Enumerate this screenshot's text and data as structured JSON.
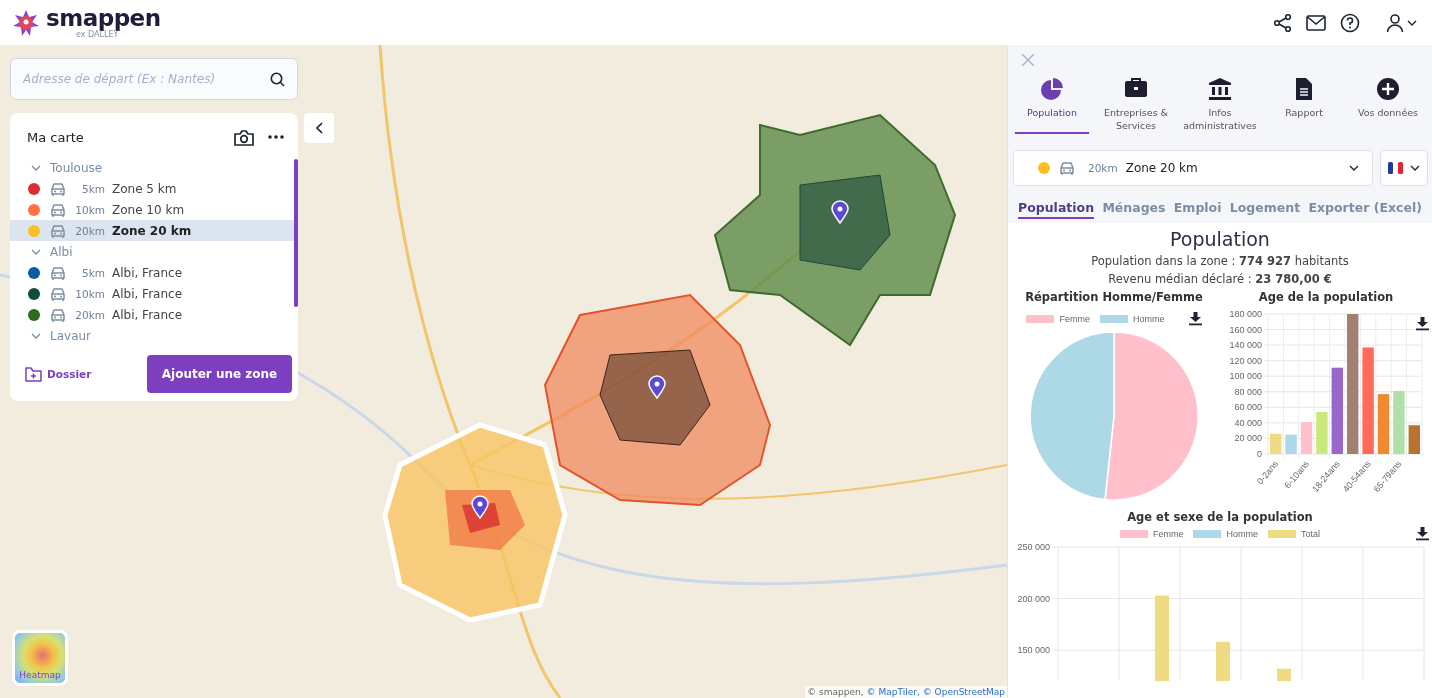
{
  "header": {
    "logo": {
      "name": "smappen",
      "sub": "ex DALLEY"
    }
  },
  "search": {
    "placeholder": "Adresse de départ (Ex : Nantes)"
  },
  "my_map": {
    "title": "Ma carte",
    "groups": [
      {
        "name": "Toulouse",
        "zones": [
          {
            "color": "#d92f2f",
            "distance": "5km",
            "label": "Zone 5 km",
            "selected": false
          },
          {
            "color": "#ff7043",
            "distance": "10km",
            "label": "Zone 10 km",
            "selected": false
          },
          {
            "color": "#fbbf24",
            "distance": "20km",
            "label": "Zone 20 km",
            "selected": true
          }
        ]
      },
      {
        "name": "Albi",
        "zones": [
          {
            "color": "#0d5aa7",
            "distance": "5km",
            "label": "Albi, France",
            "selected": false
          },
          {
            "color": "#0f4d3a",
            "distance": "10km",
            "label": "Albi, France",
            "selected": false
          },
          {
            "color": "#2e6b1f",
            "distance": "20km",
            "label": "Albi, France",
            "selected": false
          }
        ]
      },
      {
        "name": "Lavaur"
      }
    ],
    "folder_link": "Dossier",
    "add_button": "Ajouter une zone"
  },
  "heatmap": {
    "label": "Heatmap"
  },
  "attribution": [
    {
      "text": "© smappen,",
      "link": false
    },
    {
      "text": "© MapTiler,",
      "link": true
    },
    {
      "text": "© OpenStreetMap",
      "link": true
    }
  ],
  "panel": {
    "categories": [
      {
        "label": "Population",
        "selected": true
      },
      {
        "label": "Entreprises & Services",
        "selected": false
      },
      {
        "label": "Infos administratives",
        "selected": false
      },
      {
        "label": "Rapport",
        "selected": false
      },
      {
        "label": "Vos données",
        "selected": false
      }
    ],
    "zone_select": {
      "color": "#fbbf24",
      "distance": "20km",
      "label": "Zone 20 km"
    },
    "tabs": [
      {
        "label": "Population",
        "selected": true
      },
      {
        "label": "Ménages",
        "selected": false
      },
      {
        "label": "Emploi",
        "selected": false
      },
      {
        "label": "Logement",
        "selected": false
      },
      {
        "label": "Exporter (Excel)",
        "selected": false
      }
    ],
    "title": "Population",
    "stats": [
      "Population dans la zone : **774 927** habitants",
      "Revenu médian déclaré : **23 780,00 €**"
    ],
    "gender_chart": {
      "title": "Répartition Homme/Femme",
      "legend": [
        {
          "label": "Femme",
          "color": "#ffc0cb"
        },
        {
          "label": "Homme",
          "color": "#add8e6"
        }
      ]
    },
    "age_chart": {
      "title": "Age de la population",
      "chart_data": {
        "type": "bar",
        "grid": true,
        "categories": [
          "0-2ans",
          null,
          "6-10ans",
          null,
          "18-24ans",
          null,
          "40-54ans",
          null,
          "65-79ans",
          null
        ],
        "values": [
          26000,
          25000,
          41000,
          54000,
          111000,
          180000,
          137000,
          77000,
          81000,
          37000
        ],
        "colors": [
          "#efdc82",
          "#add8e6",
          "#ffc0cb",
          "#c9ea7a",
          "#9966cc",
          "#a08070",
          "#ff6a5a",
          "#ef8a30",
          "#b0e0a8",
          "#b87333"
        ],
        "ylim": [
          0,
          180000
        ],
        "yticks": [
          {
            "value": 0,
            "label": "0"
          },
          {
            "value": 20000,
            "label": "20 000"
          },
          {
            "value": 40000,
            "label": "40 000"
          },
          {
            "value": 60000,
            "label": "60 000"
          },
          {
            "value": 80000,
            "label": "80 000"
          },
          {
            "value": 100000,
            "label": "100 000"
          },
          {
            "value": 120000,
            "label": "120 000"
          },
          {
            "value": 140000,
            "label": "140 000"
          },
          {
            "value": 160000,
            "label": "160 000"
          },
          {
            "value": 180000,
            "label": "180 000"
          }
        ]
      }
    },
    "age_sex_chart": {
      "title": "Age et sexe de la population",
      "chart_data": {
        "type": "bar",
        "grid": true,
        "categories": [
          null,
          null,
          null,
          null,
          null,
          null
        ],
        "series": [
          {
            "name": "Femme",
            "color": "#ffc0cb",
            "values": [
              null,
              null,
              null,
              null,
              null,
              null
            ]
          },
          {
            "name": "Homme",
            "color": "#add8e6",
            "values": [
              null,
              null,
              null,
              null,
              null,
              null
            ]
          },
          {
            "name": "Total",
            "color": "#efdc82",
            "values": [
              null,
              203000,
              158000,
              132000,
              null,
              null
            ]
          }
        ],
        "ylim": [
          120000,
          250000
        ],
        "yticks": [
          {
            "value": 150000,
            "label": "150 000"
          },
          {
            "value": 200000,
            "label": "200 000"
          },
          {
            "value": 250000,
            "label": "250 000"
          }
        ]
      }
    }
  }
}
